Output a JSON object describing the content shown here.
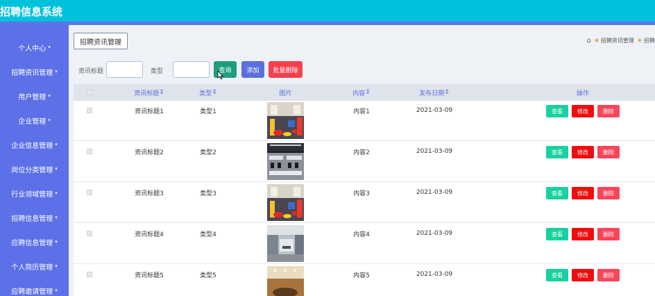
{
  "app": {
    "title": "招聘信息系统"
  },
  "sidebar": {
    "items": [
      {
        "label": "个人中心"
      },
      {
        "label": "招聘资讯管理"
      },
      {
        "label": "用户管理"
      },
      {
        "label": "企业管理"
      },
      {
        "label": "企业信息管理"
      },
      {
        "label": "岗位分类管理"
      },
      {
        "label": "行业领域管理"
      },
      {
        "label": "招聘信息管理"
      },
      {
        "label": "应聘信息管理"
      },
      {
        "label": "个人简历管理"
      },
      {
        "label": "应聘邀请管理"
      }
    ]
  },
  "header": {
    "tag": "招聘资讯管理",
    "breadcrumb": [
      "招聘资讯管理",
      "招聘"
    ]
  },
  "search": {
    "title_label": "资讯标题",
    "title_value": "",
    "type_label": "类型",
    "type_value": "",
    "query_label": "查询",
    "add_label": "添加",
    "batch_delete_label": "批量删除"
  },
  "table": {
    "columns": [
      "资讯标题",
      "类型",
      "图片",
      "内容",
      "发布日期",
      "操作"
    ],
    "sortable_suffix": "⇕",
    "actions": {
      "view": "查看",
      "edit": "修改",
      "delete": "删除"
    },
    "rows": [
      {
        "title": "资讯标题1",
        "type": "类型1",
        "content": "内容1",
        "date": "2021-03-09",
        "image": "office-lounge"
      },
      {
        "title": "资讯标题2",
        "type": "类型2",
        "content": "内容2",
        "date": "2021-03-09",
        "image": "open-office"
      },
      {
        "title": "资讯标题3",
        "type": "类型3",
        "content": "内容3",
        "date": "2021-03-09",
        "image": "office-lounge"
      },
      {
        "title": "资讯标题4",
        "type": "类型4",
        "content": "内容4",
        "date": "2021-03-09",
        "image": "office-hall"
      },
      {
        "title": "资讯标题5",
        "type": "类型5",
        "content": "内容5",
        "date": "2021-03-09",
        "image": "meeting-room"
      }
    ]
  },
  "colors": {
    "topbar": "#00c1dc",
    "sidebar": "#5c70e8",
    "query": "#1f9e7f",
    "add": "#5a6fe0",
    "batch_delete": "#f5404e",
    "view": "#19d1a0",
    "edit": "#f10d0d",
    "delete": "#f9455a",
    "header_text": "#5a6fe0"
  },
  "icons": {
    "home": "home-icon",
    "crumb": "star-icon",
    "caret": "caret-down-icon",
    "sort": "sort-icon"
  }
}
